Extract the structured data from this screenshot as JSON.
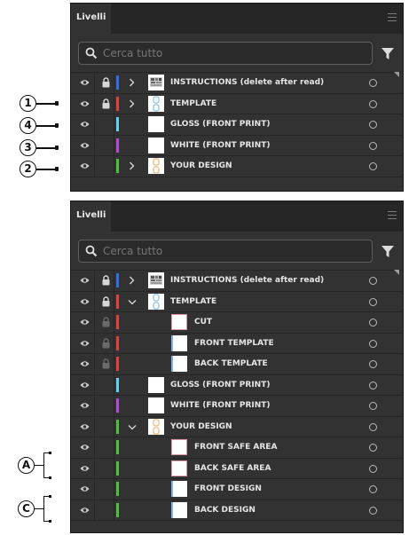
{
  "panel1": {
    "tab": "Livelli",
    "search_placeholder": "Cerca tutto",
    "layers": [
      {
        "name": "INSTRUCTIONS (delete after read)",
        "color": "#2f6fe0",
        "locked": true,
        "expander": "right",
        "thumb": "pattern",
        "indent": 0
      },
      {
        "name": "TEMPLATE",
        "color": "#e0423d",
        "locked": true,
        "expander": "right",
        "thumb": "template",
        "indent": 0
      },
      {
        "name": "GLOSS (FRONT PRINT)",
        "color": "#5fd3f0",
        "locked": false,
        "expander": "none",
        "thumb": "white",
        "indent": 0
      },
      {
        "name": "WHITE (FRONT PRINT)",
        "color": "#b44bd6",
        "locked": false,
        "expander": "none",
        "thumb": "white",
        "indent": 0
      },
      {
        "name": "YOUR DESIGN",
        "color": "#4cc23c",
        "locked": false,
        "expander": "right",
        "thumb": "design",
        "indent": 0
      }
    ]
  },
  "panel2": {
    "tab": "Livelli",
    "search_placeholder": "Cerca tutto",
    "layers": [
      {
        "name": "INSTRUCTIONS (delete after read)",
        "color": "#2f6fe0",
        "locked": true,
        "expander": "right",
        "thumb": "pattern",
        "indent": 0
      },
      {
        "name": "TEMPLATE",
        "color": "#e0423d",
        "locked": true,
        "expander": "down",
        "thumb": "template",
        "indent": 0
      },
      {
        "name": "CUT",
        "color": "#e0423d",
        "locked": "dim",
        "expander": "none",
        "thumb": "outlined",
        "indent": 1
      },
      {
        "name": "FRONT TEMPLATE",
        "color": "#e0423d",
        "locked": "dim",
        "expander": "none",
        "thumb": "white-lb",
        "indent": 1
      },
      {
        "name": "BACK TEMPLATE",
        "color": "#e0423d",
        "locked": "dim",
        "expander": "none",
        "thumb": "white-lb",
        "indent": 1
      },
      {
        "name": "GLOSS (FRONT PRINT)",
        "color": "#5fd3f0",
        "locked": false,
        "expander": "none",
        "thumb": "white",
        "indent": 0
      },
      {
        "name": "WHITE (FRONT PRINT)",
        "color": "#b44bd6",
        "locked": false,
        "expander": "none",
        "thumb": "white",
        "indent": 0
      },
      {
        "name": "YOUR DESIGN",
        "color": "#4cc23c",
        "locked": false,
        "expander": "down",
        "thumb": "design",
        "indent": 0
      },
      {
        "name": "FRONT SAFE AREA",
        "color": "#4cc23c",
        "locked": false,
        "expander": "none",
        "thumb": "outlined",
        "indent": 1
      },
      {
        "name": "BACK SAFE AREA",
        "color": "#4cc23c",
        "locked": false,
        "expander": "none",
        "thumb": "outlined",
        "indent": 1
      },
      {
        "name": "FRONT DESIGN",
        "color": "#4cc23c",
        "locked": false,
        "expander": "none",
        "thumb": "white-lb",
        "indent": 1
      },
      {
        "name": "BACK DESIGN",
        "color": "#4cc23c",
        "locked": false,
        "expander": "none",
        "thumb": "white-lb",
        "indent": 1
      }
    ]
  },
  "callouts": {
    "one": "1",
    "four": "4",
    "three": "3",
    "two": "2",
    "a": "A",
    "c": "C"
  }
}
